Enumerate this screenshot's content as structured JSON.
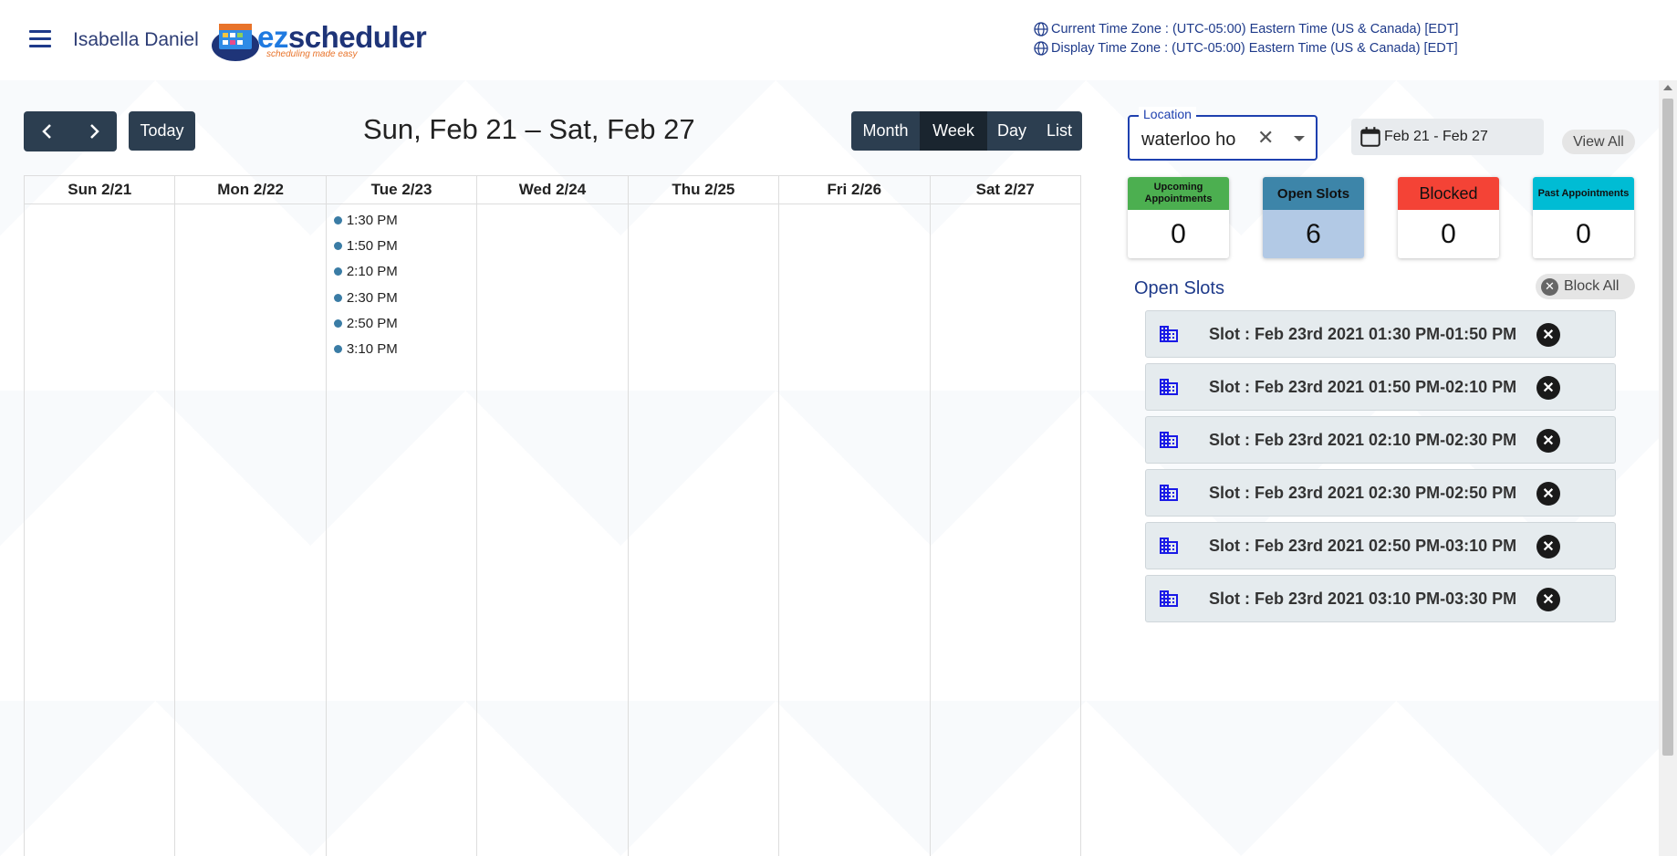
{
  "header": {
    "user_name": "Isabella Daniel",
    "logo": {
      "ez": "ez",
      "scheduler": "scheduler",
      "tagline": "scheduling made easy"
    },
    "current_tz": "Current Time Zone : (UTC-05:00) Eastern Time (US & Canada) [EDT]",
    "display_tz": "Display Time Zone : (UTC-05:00) Eastern Time (US & Canada) [EDT]"
  },
  "toolbar": {
    "prev_icon": "chevron-left-icon",
    "next_icon": "chevron-right-icon",
    "today_label": "Today",
    "range_title": "Sun, Feb 21 – Sat, Feb 27",
    "views": [
      "Month",
      "Week",
      "Day",
      "List"
    ],
    "active_view": "Week"
  },
  "calendar": {
    "days": [
      "Sun 2/21",
      "Mon 2/22",
      "Tue 2/23",
      "Wed 2/24",
      "Thu 2/25",
      "Fri 2/26",
      "Sat 2/27"
    ],
    "events_tue": [
      "1:30 PM",
      "1:50 PM",
      "2:10 PM",
      "2:30 PM",
      "2:50 PM",
      "3:10 PM"
    ],
    "event_dot_color": "#3a7ca5"
  },
  "filters": {
    "location_label": "Location",
    "location_value": "waterloo ho",
    "date_range": "Feb 21 - Feb 27",
    "view_all_label": "View All"
  },
  "stats": [
    {
      "label": "Upcoming Appointments",
      "value": "0",
      "color": "#4caf50"
    },
    {
      "label": "Open Slots",
      "value": "6",
      "color": "#3d85a9"
    },
    {
      "label": "Blocked",
      "value": "0",
      "color": "#f44336"
    },
    {
      "label": "Past Appointments",
      "value": "0",
      "color": "#00bcd4"
    }
  ],
  "open_slots": {
    "title": "Open Slots",
    "block_all_label": "Block All",
    "items": [
      "Slot : Feb 23rd 2021 01:30 PM-01:50 PM",
      "Slot : Feb 23rd 2021 01:50 PM-02:10 PM",
      "Slot : Feb 23rd 2021 02:10 PM-02:30 PM",
      "Slot : Feb 23rd 2021 02:30 PM-02:50 PM",
      "Slot : Feb 23rd 2021 02:50 PM-03:10 PM",
      "Slot : Feb 23rd 2021 03:10 PM-03:30 PM"
    ]
  }
}
